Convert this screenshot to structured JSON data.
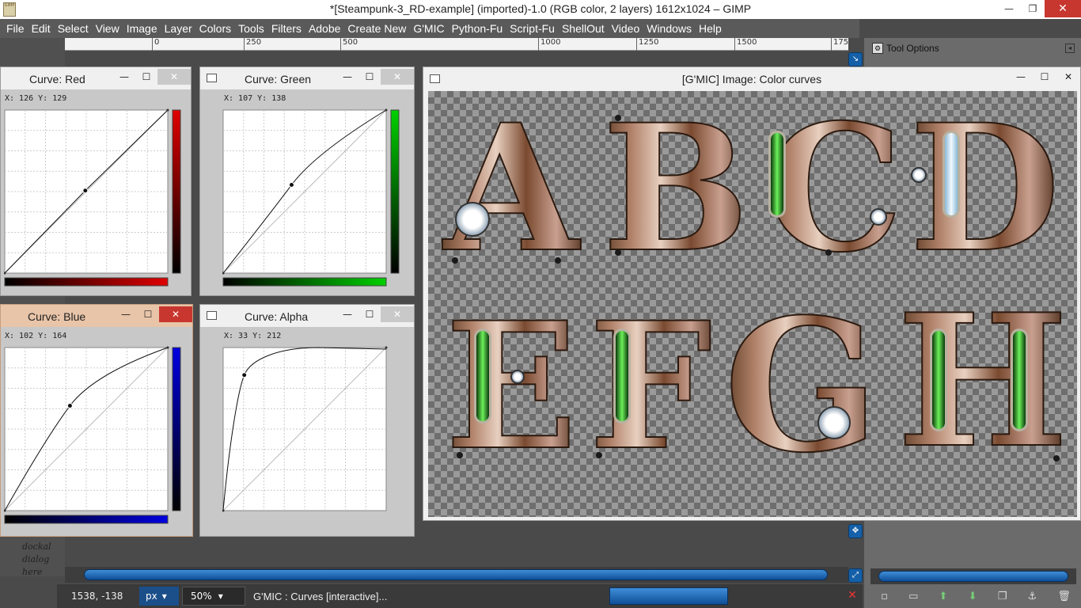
{
  "window": {
    "title": "*[Steampunk-3_RD-example] (imported)-1.0 (RGB color, 2 layers) 1612x1024 – GIMP",
    "app_icon_text": "GIMP",
    "minimize": "—",
    "maximize": "❐",
    "close": "✕"
  },
  "menu": [
    "File",
    "Edit",
    "Select",
    "View",
    "Image",
    "Layer",
    "Colors",
    "Tools",
    "Filters",
    "Adobe",
    "Create New",
    "G'MIC",
    "Python-Fu",
    "Script-Fu",
    "ShellOut",
    "Video",
    "Windows",
    "Help"
  ],
  "ruler": {
    "labels": [
      "0",
      "250",
      "500",
      "1000",
      "1250",
      "1500",
      "175"
    ]
  },
  "dock": {
    "tool_options_label": "Tool Options",
    "dockable_text": [
      "dockal",
      "dialog",
      "here"
    ],
    "bottom_icons": [
      "new-icon",
      "folder-icon",
      "up-icon",
      "down-icon",
      "duplicate-icon",
      "anchor-icon",
      "delete-icon"
    ]
  },
  "status": {
    "coords": "1538, -138",
    "unit": "px",
    "zoom": "50",
    "zoom_unit": "%",
    "message": "G'MIC : Curves [interactive]...",
    "cancel": "✕"
  },
  "curves": [
    {
      "title": "Curve: Red",
      "xy": "X: 126  Y: 129",
      "color": "#e00000",
      "active": false
    },
    {
      "title": "Curve: Green",
      "xy": "X: 107  Y: 138",
      "color": "#00d000",
      "active": false
    },
    {
      "title": "Curve: Blue",
      "xy": "X: 102  Y: 164",
      "color": "#0000e0",
      "active": true
    },
    {
      "title": "Curve: Alpha",
      "xy": "X: 33  Y: 212",
      "color": "#000000",
      "active": false
    }
  ],
  "gmic": {
    "title": "[G'MIC] Image: Color curves",
    "letters": [
      "A",
      "B",
      "C",
      "D",
      "E",
      "F",
      "G",
      "H"
    ]
  },
  "colors": {
    "accent": "#1560a8",
    "close_red": "#c7372f",
    "active_dialog": "#e8c4a8"
  }
}
